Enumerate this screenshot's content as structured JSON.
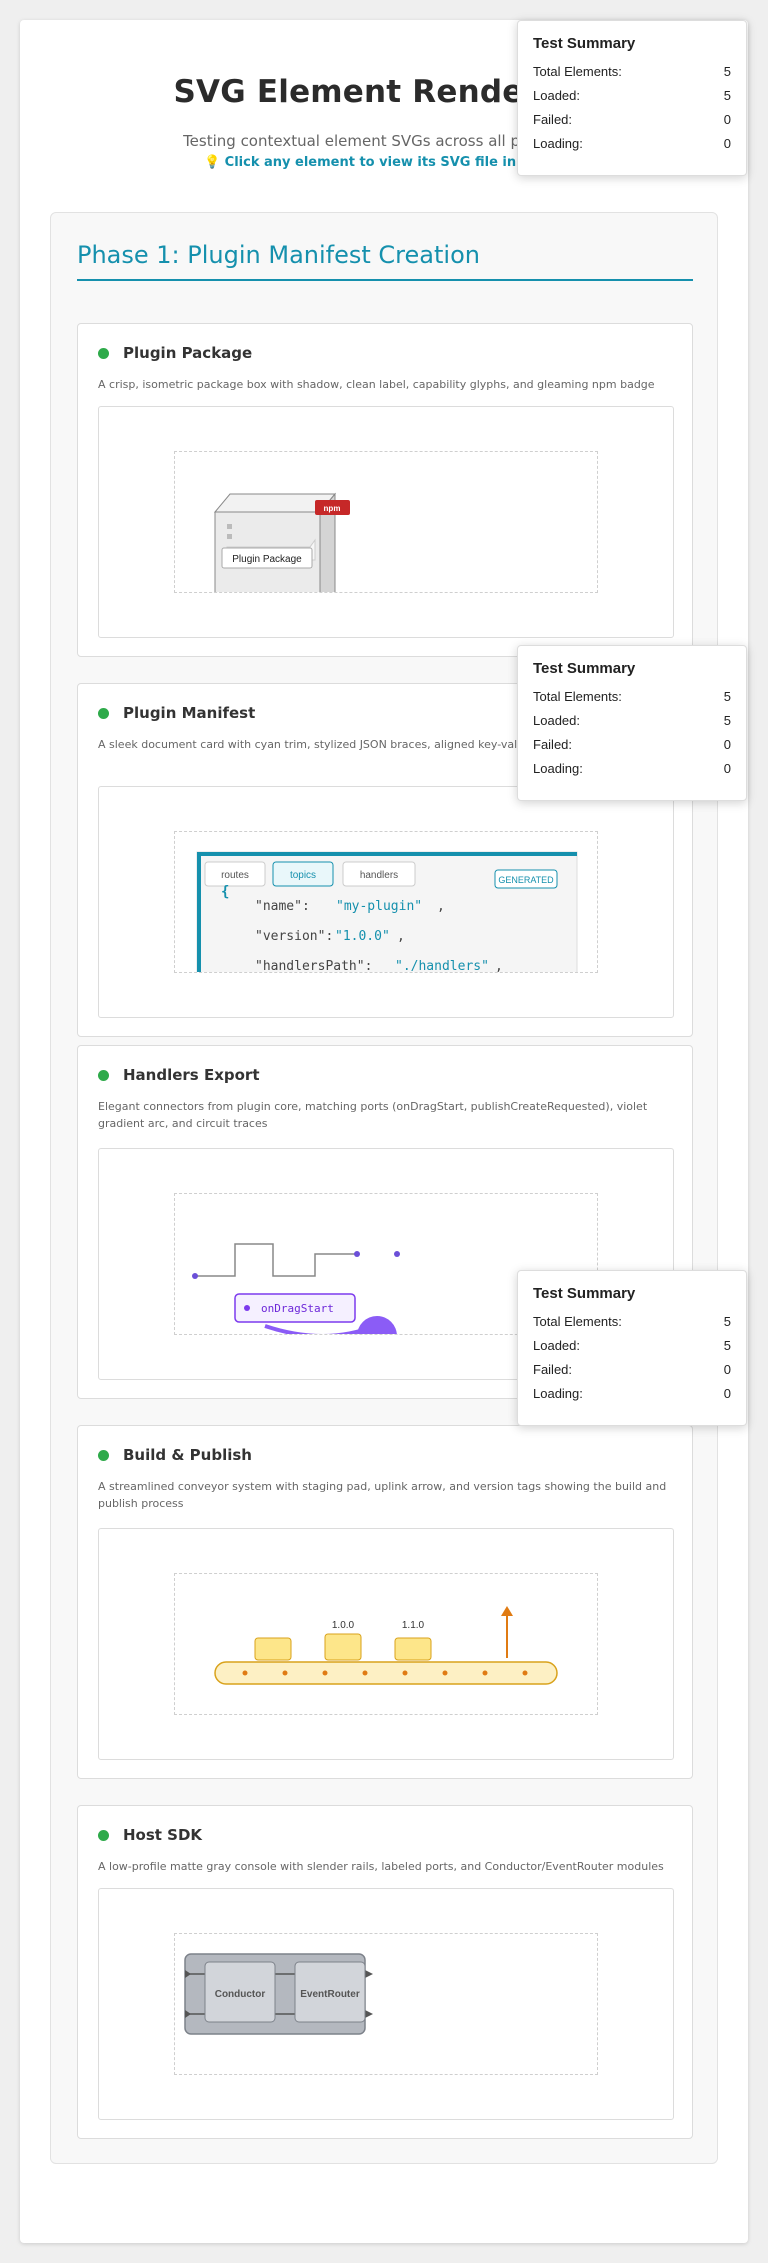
{
  "header": {
    "title": "SVG Element Rendering",
    "subtitle": "Testing contextual element SVGs across all plugin arc",
    "hint": "💡 Click any element to view its SVG file in a new"
  },
  "phase": {
    "title": "Phase 1: Plugin Manifest Creation"
  },
  "status_color": "#2eaa4a",
  "accent_color": "#1590ad",
  "cards": [
    {
      "name": "Plugin Package",
      "desc": "A crisp, isometric package box with shadow, clean label, capability glyphs, and gleaming npm badge",
      "svg": {
        "label": "Plugin Package",
        "badge": "npm"
      }
    },
    {
      "name": "Plugin Manifest",
      "desc": "A sleek document card with cyan trim, stylized JSON braces, aligned key-value r navigation tabs",
      "svg": {
        "tabs": [
          "routes",
          "topics",
          "handlers"
        ],
        "badge": "GENERATED",
        "brace": "{",
        "lines": [
          {
            "key": "\"name\":",
            "value": "\"my-plugin\"",
            "trail": ","
          },
          {
            "key": "\"version\":",
            "value": "\"1.0.0\"",
            "trail": ","
          },
          {
            "key": "\"handlersPath\":",
            "value": "\"./handlers\"",
            "trail": ","
          }
        ]
      }
    },
    {
      "name": "Handlers Export",
      "desc": "Elegant connectors from plugin core, matching ports (onDragStart, publishCreateRequested), violet gradient arc, and circuit traces",
      "svg": {
        "port": "onDragStart"
      }
    },
    {
      "name": "Build & Publish",
      "desc": "A streamlined conveyor system with staging pad, uplink arrow, and version tags showing the build and publish process",
      "svg": {
        "tags": [
          "1.0.0",
          "1.1.0"
        ]
      }
    },
    {
      "name": "Host SDK",
      "desc": "A low-profile matte gray console with slender rails, labeled ports, and Conductor/EventRouter modules",
      "svg": {
        "modules": [
          "Conductor",
          "EventRouter"
        ]
      }
    }
  ],
  "summary": {
    "title": "Test Summary",
    "rows": [
      {
        "label": "Total Elements:",
        "value": "5"
      },
      {
        "label": "Loaded:",
        "value": "5"
      },
      {
        "label": "Failed:",
        "value": "0"
      },
      {
        "label": "Loading:",
        "value": "0"
      }
    ]
  }
}
